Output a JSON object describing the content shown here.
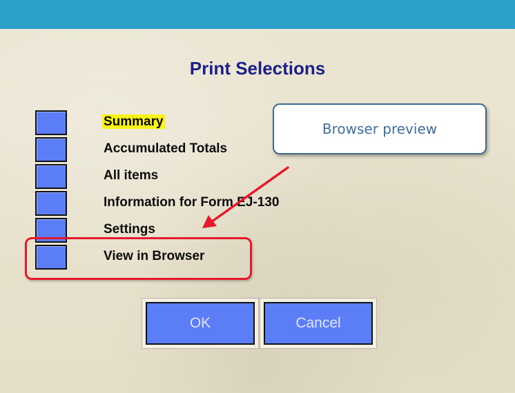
{
  "dialog": {
    "title": "Print Selections"
  },
  "options": [
    {
      "label": "Summary",
      "highlighted": true
    },
    {
      "label": "Accumulated Totals",
      "highlighted": false
    },
    {
      "label": "All items",
      "highlighted": false
    },
    {
      "label": "Information for Form EJ-130",
      "highlighted": false
    },
    {
      "label": "Settings",
      "highlighted": false
    },
    {
      "label": "View in Browser",
      "highlighted": false
    }
  ],
  "callout": {
    "text": "Browser preview"
  },
  "buttons": {
    "ok_label": "OK",
    "cancel_label": "Cancel"
  },
  "colors": {
    "titlebar": "#2da0c9",
    "title_text": "#1c1f86",
    "button_fill": "#5b7df5",
    "highlight_yellow": "#fbf313",
    "annotation_red": "#e5192a",
    "callout_border": "#3e6892",
    "callout_text": "#3f6ea0"
  }
}
